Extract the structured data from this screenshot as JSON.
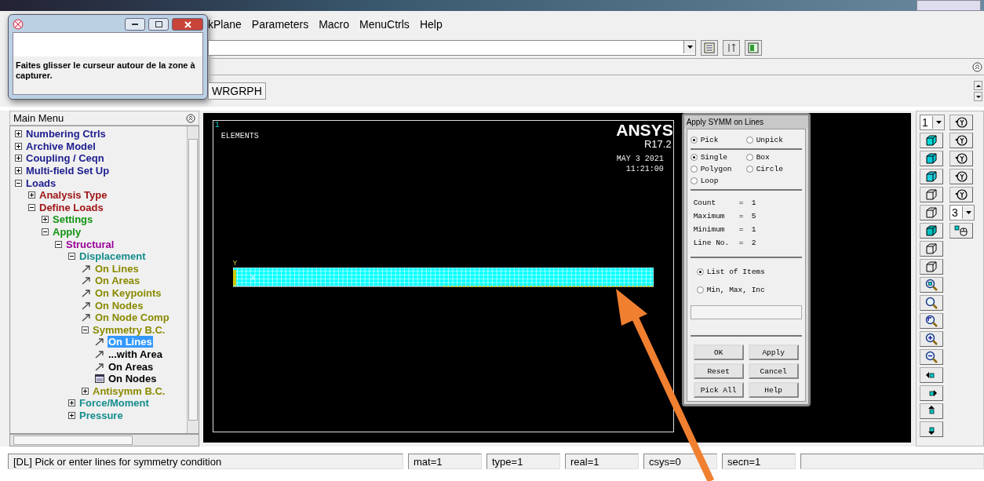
{
  "snip_popup": {
    "message": "Faites glisser le curseur autour de la zone à capturer."
  },
  "menu_bar": [
    "kPlane",
    "Parameters",
    "Macro",
    "MenuCtrls",
    "Help"
  ],
  "toolbar": {
    "buttons": [
      "WRGRPH"
    ]
  },
  "main_menu": {
    "title": "Main Menu",
    "items": [
      {
        "label": "Numbering Ctrls",
        "kind": "folder",
        "expanded": false,
        "selected": false
      },
      {
        "label": "Archive Model",
        "kind": "folder",
        "expanded": false,
        "selected": false
      },
      {
        "label": "Coupling / Ceqn",
        "kind": "folder",
        "expanded": false,
        "selected": false
      },
      {
        "label": "Multi-field Set Up",
        "kind": "folder",
        "expanded": false,
        "selected": false
      },
      {
        "label": "Loads",
        "kind": "folder",
        "expanded": true,
        "selected": false,
        "children": [
          {
            "label": "Analysis Type",
            "kind": "folder",
            "expanded": false,
            "selected": false
          },
          {
            "label": "Define Loads",
            "kind": "folder",
            "expanded": true,
            "selected": false,
            "children": [
              {
                "label": "Settings",
                "kind": "folder",
                "expanded": false,
                "selected": false
              },
              {
                "label": "Apply",
                "kind": "folder",
                "expanded": true,
                "selected": false,
                "children": [
                  {
                    "label": "Structural",
                    "kind": "folder",
                    "expanded": true,
                    "selected": false,
                    "children": [
                      {
                        "label": "Displacement",
                        "kind": "folder",
                        "expanded": true,
                        "selected": false,
                        "children": [
                          {
                            "label": "On Lines",
                            "kind": "action",
                            "selected": false
                          },
                          {
                            "label": "On Areas",
                            "kind": "action",
                            "selected": false
                          },
                          {
                            "label": "On Keypoints",
                            "kind": "action",
                            "selected": false
                          },
                          {
                            "label": "On Nodes",
                            "kind": "action",
                            "selected": false
                          },
                          {
                            "label": "On Node Comp",
                            "kind": "action",
                            "selected": false
                          },
                          {
                            "label": "Symmetry B.C.",
                            "kind": "folder",
                            "expanded": true,
                            "selected": false,
                            "children": [
                              {
                                "label": "On Lines",
                                "kind": "action",
                                "selected": true
                              },
                              {
                                "label": "...with Area",
                                "kind": "action",
                                "selected": false
                              },
                              {
                                "label": "On Areas",
                                "kind": "action",
                                "selected": false
                              },
                              {
                                "label": "On Nodes",
                                "kind": "dialog",
                                "selected": false
                              }
                            ]
                          },
                          {
                            "label": "Antisymm B.C.",
                            "kind": "folder",
                            "expanded": false,
                            "selected": false
                          }
                        ]
                      },
                      {
                        "label": "Force/Moment",
                        "kind": "folder",
                        "expanded": false,
                        "selected": false
                      },
                      {
                        "label": "Pressure",
                        "kind": "folder",
                        "expanded": false,
                        "selected": false
                      }
                    ]
                  }
                ]
              }
            ]
          }
        ]
      }
    ]
  },
  "graphics": {
    "window_number": "1",
    "label": "ELEMENTS",
    "logo": "ANSYS",
    "version": "R17.2",
    "date": "MAY  3 2021",
    "time": "11:21:00",
    "axis_labels": [
      "Y",
      "X"
    ]
  },
  "dialog": {
    "title": "Apply SYMM on Lines",
    "pick_mode": [
      {
        "label": "Pick",
        "selected": true
      },
      {
        "label": "Unpick",
        "selected": false
      }
    ],
    "pick_shape": [
      {
        "label": "Single",
        "selected": true
      },
      {
        "label": "Box",
        "selected": false
      },
      {
        "label": "Polygon",
        "selected": false
      },
      {
        "label": "Circle",
        "selected": false
      },
      {
        "label": "Loop",
        "selected": false
      }
    ],
    "info": [
      {
        "label": "Count",
        "sign": "=",
        "value": "1"
      },
      {
        "label": "Maximum",
        "sign": "=",
        "value": "5"
      },
      {
        "label": "Minimum",
        "sign": "=",
        "value": "1"
      },
      {
        "label": "Line No.",
        "sign": "=",
        "value": "2"
      }
    ],
    "input_mode": [
      {
        "label": "List of Items",
        "selected": true
      },
      {
        "label": "Min, Max, Inc",
        "selected": false
      }
    ],
    "buttons": [
      "OK",
      "Apply",
      "Reset",
      "Cancel",
      "Pick All",
      "Help"
    ]
  },
  "right_toolbar": {
    "column_1_dropdown": "1",
    "column_2_dropdown": "3"
  },
  "status_bar": [
    "[DL]  Pick or enter lines for symmetry condition",
    "mat=1",
    "type=1",
    "real=1",
    "csys=0",
    "secn=1"
  ]
}
